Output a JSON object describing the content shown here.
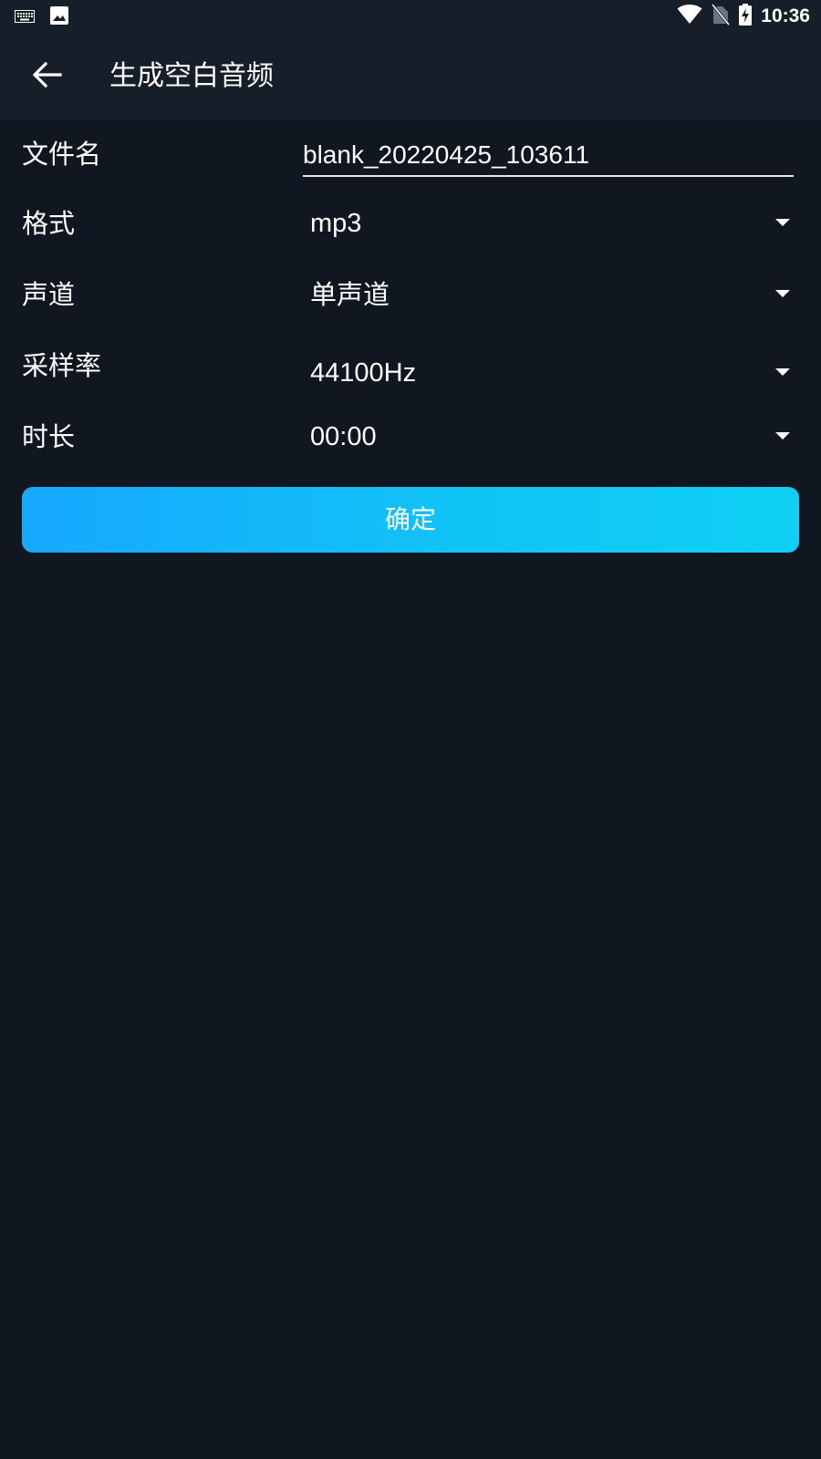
{
  "status_bar": {
    "time": "10:36",
    "icons": [
      "keyboard-icon",
      "image-icon",
      "wifi-icon",
      "no-sim-icon",
      "battery-charging-icon"
    ]
  },
  "app_bar": {
    "title": "生成空白音频",
    "back_icon": "arrow-left-icon"
  },
  "form": {
    "filename": {
      "label": "文件名",
      "value": "blank_20220425_103611"
    },
    "format": {
      "label": "格式",
      "value": "mp3"
    },
    "channel": {
      "label": "声道",
      "value": "单声道"
    },
    "sample_rate": {
      "label": "采样率",
      "value": "44100Hz"
    },
    "duration": {
      "label": "时长",
      "value": "00:00"
    }
  },
  "confirm_button": {
    "label": "确定"
  },
  "colors": {
    "background": "#101720",
    "app_bar": "#161e29",
    "button_gradient_start": "#17a8ff",
    "button_gradient_end": "#0fd0f4"
  }
}
